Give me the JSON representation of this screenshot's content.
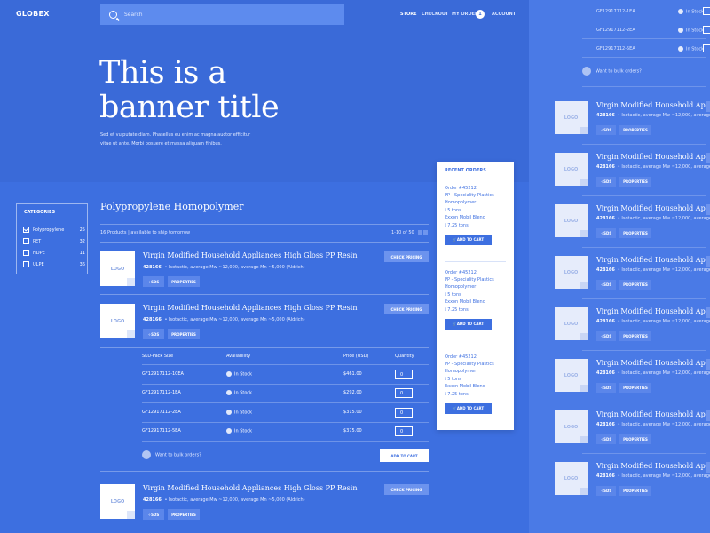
{
  "header": {
    "logo": "GLOBEX",
    "search_placeholder": "Search",
    "nav": [
      "STORE",
      "CHECKOUT",
      "MY ORDER",
      "ACCOUNT"
    ],
    "order_count": "1"
  },
  "banner": {
    "title_line1": "This is a",
    "title_line2": "banner title",
    "subtitle_line1": "Sed et vulputate diam. Phasellus eu enim ac magna auctor efficitur",
    "subtitle_line2": "vitae ut ante. Morbi posuere et massa aliquam finibus."
  },
  "categories": {
    "title": "CATEGORIES",
    "items": [
      {
        "label": "Polypropylene",
        "count": "25",
        "checked": true
      },
      {
        "label": "PET",
        "count": "32",
        "checked": false
      },
      {
        "label": "HDPE",
        "count": "11",
        "checked": false
      },
      {
        "label": "ULPE",
        "count": "36",
        "checked": false
      }
    ]
  },
  "listing": {
    "title": "Polypropylene Homopolymer",
    "count_text": "16 Products | available to ship tomorrow",
    "pager": "1-10 of 50"
  },
  "product": {
    "title": "Virgin Modified Household Appliances High Gloss PP Resin",
    "id": "428166",
    "meta": "Isotactic, average Mw ~12,000, average Mn ~5,000 (Aldrich)",
    "sds": "SDS",
    "properties": "PROPERTIES",
    "check_pricing": "CHECK PRICING",
    "logo": "LOGO"
  },
  "sku_table": {
    "headers": [
      "SKU-Pack Size",
      "Availability",
      "Price (USD)",
      "Quantity"
    ],
    "rows": [
      {
        "sku": "GF12917112-10EA",
        "stock": "In Stock",
        "price": "$461.00",
        "qty": "0"
      },
      {
        "sku": "GF12917112-1EA",
        "stock": "In Stock",
        "price": "$292.00",
        "qty": "0"
      },
      {
        "sku": "GF12917112-2EA",
        "stock": "In Stock",
        "price": "$315.00",
        "qty": "0"
      },
      {
        "sku": "GF12917112-5EA",
        "stock": "In Stock",
        "price": "$375.00",
        "qty": "0"
      }
    ],
    "bulk_text": "Want to bulk orders?",
    "add_to_cart": "ADD TO CART"
  },
  "recent_orders": {
    "title": "RECENT ORDERS",
    "orders": [
      {
        "order": "Order #45212",
        "line1": "PP - Speciality Plastics",
        "line2": "Homopolymer",
        "tons1": "5 tons",
        "supplier": "Exxon Mobil Blend",
        "tons2": "7.25 tons",
        "button": "ADD TO CART"
      },
      {
        "order": "Order #45212",
        "line1": "PP - Speciality Plastics",
        "line2": "Homopolymer",
        "tons1": "5 tons",
        "supplier": "Exxon Mobil Blend",
        "tons2": "7.25 tons",
        "button": "ADD TO CART"
      },
      {
        "order": "Order #45212",
        "line1": "PP - Speciality Plastics",
        "line2": "Homopolymer",
        "tons1": "5 tons",
        "supplier": "Exxon Mobil Blend",
        "tons2": "7.25 tons",
        "button": "ADD TO CART"
      }
    ]
  },
  "side_panel": {
    "sku_rows": [
      {
        "sku": "GF12917112-1EA",
        "stock": "In Stock"
      },
      {
        "sku": "GF12917112-2EA",
        "stock": "In Stock"
      },
      {
        "sku": "GF12917112-5EA",
        "stock": "In Stock"
      }
    ],
    "bulk_text": "Want to bulk orders?"
  }
}
